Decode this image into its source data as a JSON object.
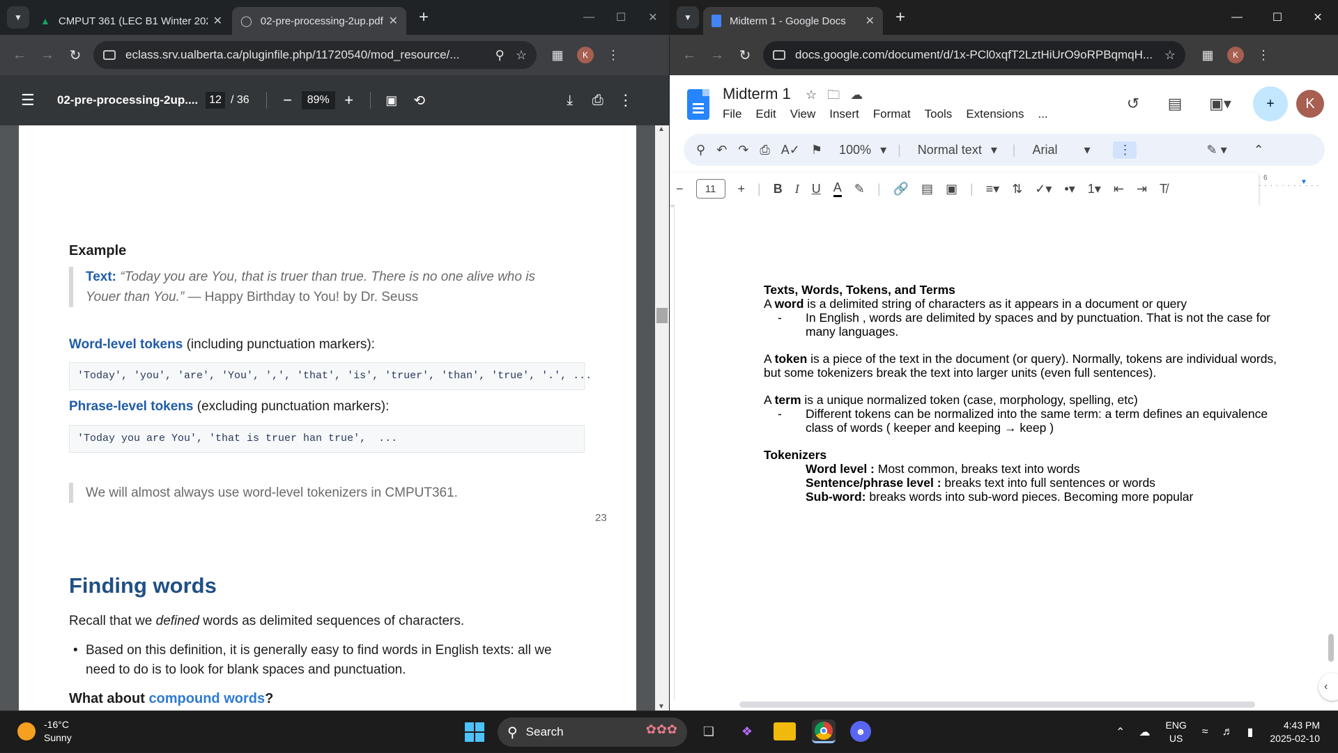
{
  "left_browser": {
    "tabs": [
      {
        "title": "CMPUT 361 (LEC B1 Winter 202",
        "active": false
      },
      {
        "title": "02-pre-processing-2up.pdf",
        "active": true
      }
    ],
    "url": "eclass.srv.ualberta.ca/pluginfile.php/11720540/mod_resource/...",
    "profile_initial": "K"
  },
  "pdf_viewer": {
    "file_name": "02-pre-processing-2up....",
    "current_page": "12",
    "total_pages": "/ 36",
    "zoom": "89%"
  },
  "pdf_page": {
    "example_heading": "Example",
    "text_label": "Text:",
    "quote_body": "“Today you are You, that is truer than true. There is no one alive who is Youer than You.”",
    "quote_attribution": "— Happy Birthday to You! by Dr. Seuss",
    "word_level_link": "Word-level tokens",
    "word_level_rest": "(including punctuation markers):",
    "word_level_code": "'Today', 'you', 'are', 'You', ',', 'that', 'is', 'truer', 'than', 'true', '.', ...",
    "phrase_level_link": "Phrase-level tokens",
    "phrase_level_rest": "(excluding punctuation markers):",
    "phrase_level_code": "'Today you are You', 'that is truer han true',  ...",
    "note": "We will almost always use word-level tokenizers in CMPUT361.",
    "page_number": "23",
    "finding_heading": "Finding words",
    "recall_pre": "Recall that we",
    "recall_em": "defined",
    "recall_post": "words as delimited sequences of characters.",
    "bullet": "Based on this definition, it is generally easy to find words in English texts: all we need to do is to look for blank spaces and punctuation.",
    "what_about_pre": "What about",
    "what_about_link": "compound words",
    "what_about_post": "?"
  },
  "right_browser": {
    "tabs": [
      {
        "title": "Midterm 1 - Google Docs",
        "active": true
      }
    ],
    "url": "docs.google.com/document/d/1x-PCl0xqfT2LztHiUrO9oRPBqmqH...",
    "profile_initial": "K"
  },
  "docs": {
    "title": "Midterm 1",
    "menus": [
      "File",
      "Edit",
      "View",
      "Insert",
      "Format",
      "Tools",
      "Extensions",
      "..."
    ],
    "zoom": "100%",
    "style": "Normal text",
    "font": "Arial",
    "font_size": "11",
    "ruler_mark": "6",
    "content": {
      "heading1": "Texts, Words, Tokens, and Terms",
      "word_pre": "A",
      "word_bold": "word",
      "word_post": "is a delimited string of characters as it appears in a document or query",
      "word_bullet_1": "In English , words are delimited by spaces and by punctuation. That is not the case for",
      "word_bullet_2": "many languages.",
      "token_pre": "A",
      "token_bold": "token",
      "token_post": "is a piece of the text in the document (or query). Normally, tokens are individual words,",
      "token_line2": "but some tokenizers break the text into larger units (even full sentences).",
      "term_pre": "A",
      "term_bold": "term",
      "term_post": "is a unique normalized token (case, morphology, spelling, etc)",
      "term_bullet_1": "Different tokens can be normalized into the same term: a term defines an equivalence",
      "term_bullet_2": "class of words ( keeper and keeping → keep )",
      "tokenizers_heading": "Tokenizers",
      "tok1_bold": "Word level :",
      "tok1_rest": "Most common, breaks text into words",
      "tok2_bold": "Sentence/phrase level :",
      "tok2_rest": "breaks text into full sentences or words",
      "tok3_bold": "Sub-word:",
      "tok3_rest": "breaks words into sub-word pieces. Becoming more popular"
    }
  },
  "taskbar": {
    "temperature": "-16°C",
    "weather": "Sunny",
    "search_placeholder": "Search",
    "language": "ENG",
    "region": "US",
    "time": "4:43 PM",
    "date": "2025-02-10"
  }
}
